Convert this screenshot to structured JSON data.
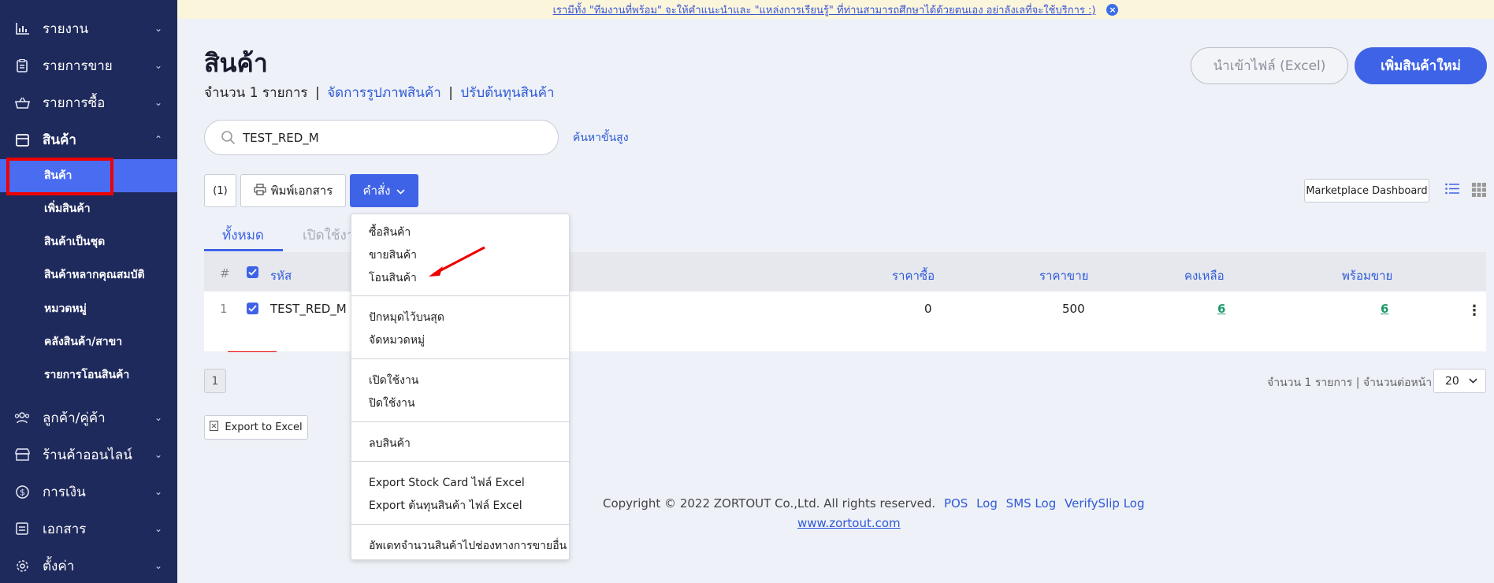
{
  "banner": {
    "text": "เรามีทั้ง \"ทีมงานที่พร้อม\" จะให้คำแนะนำและ \"แหล่งการเรียนรู้\" ที่ท่านสามารถศึกษาได้ด้วยตนเอง อย่าลังเลที่จะใช้บริการ :)",
    "close": "×"
  },
  "sidebar": {
    "items": [
      {
        "label": "รายงาน",
        "icon": "chart-icon"
      },
      {
        "label": "รายการขาย",
        "icon": "clipboard-icon"
      },
      {
        "label": "รายการซื้อ",
        "icon": "basket-icon"
      },
      {
        "label": "สินค้า",
        "icon": "box-icon"
      },
      {
        "label": "ลูกค้า/คู่ค้า",
        "icon": "users-icon"
      },
      {
        "label": "ร้านค้าออนไลน์",
        "icon": "store-icon"
      },
      {
        "label": "การเงิน",
        "icon": "dollar-icon"
      },
      {
        "label": "เอกสาร",
        "icon": "document-icon"
      },
      {
        "label": "ตั้งค่า",
        "icon": "gear-icon"
      }
    ],
    "subitems": [
      {
        "label": "สินค้า"
      },
      {
        "label": "เพิ่มสินค้า"
      },
      {
        "label": "สินค้าเป็นชุด"
      },
      {
        "label": "สินค้าหลากคุณสมบัติ"
      },
      {
        "label": "หมวดหมู่"
      },
      {
        "label": "คลังสินค้า/สาขา"
      },
      {
        "label": "รายการโอนสินค้า"
      }
    ]
  },
  "header": {
    "title": "สินค้า",
    "count": "จำนวน 1 รายการ",
    "sep": "|",
    "link_images": "จัดการรูปภาพสินค้า",
    "link_cost": "ปรับต้นทุนสินค้า",
    "import_label": "นำเข้าไฟล์ (Excel)",
    "add_label": "เพิ่มสินค้าใหม่"
  },
  "search": {
    "value": "TEST_RED_M",
    "advanced": "ค้นหาขั้นสูง"
  },
  "toolbar": {
    "selected_count": "(1)",
    "print_label": "พิมพ์เอกสาร",
    "command_label": "คำสั่ง",
    "marketplace_label": "Marketplace Dashboard"
  },
  "tabs": [
    {
      "label": "ทั้งหมด"
    },
    {
      "label": "เปิดใช้งาน"
    }
  ],
  "table": {
    "headers": {
      "index": "#",
      "code": "รหัส",
      "buy_price": "ราคาซื้อ",
      "sell_price": "ราคาขาย",
      "remaining": "คงเหลือ",
      "available": "พร้อมขาย"
    },
    "rows": [
      {
        "index": "1",
        "code": "TEST_RED_M",
        "buy_price": "0",
        "sell_price": "500",
        "remaining": "6",
        "available": "6"
      }
    ]
  },
  "pagination": {
    "page": "1",
    "summary": "จำนวน 1 รายการ | จำนวนต่อหน้า",
    "per_page": "20"
  },
  "export_label": "Export to Excel",
  "dropdown": {
    "groups": [
      [
        "ซื้อสินค้า",
        "ขายสินค้า",
        "โอนสินค้า"
      ],
      [
        "ปักหมุดไว้บนสุด",
        "จัดหมวดหมู่"
      ],
      [
        "เปิดใช้งาน",
        "ปิดใช้งาน"
      ],
      [
        "ลบสินค้า"
      ],
      [
        "Export Stock Card ไฟล์ Excel",
        "Export ต้นทุนสินค้า ไฟล์ Excel"
      ],
      [
        "อัพเดทจำนวนสินค้าไปช่องทางการขายอื่น"
      ]
    ]
  },
  "footer": {
    "copyright": "Copyright © 2022 ZORTOUT Co.,Ltd. All rights reserved.",
    "links": [
      "POS",
      "Log",
      "SMS Log",
      "VerifySlip Log"
    ],
    "website": "www.zortout.com"
  },
  "colors": {
    "sidebar_bg": "#1f2a5c",
    "accent": "#3f63e6",
    "highlight": "#e00000"
  }
}
